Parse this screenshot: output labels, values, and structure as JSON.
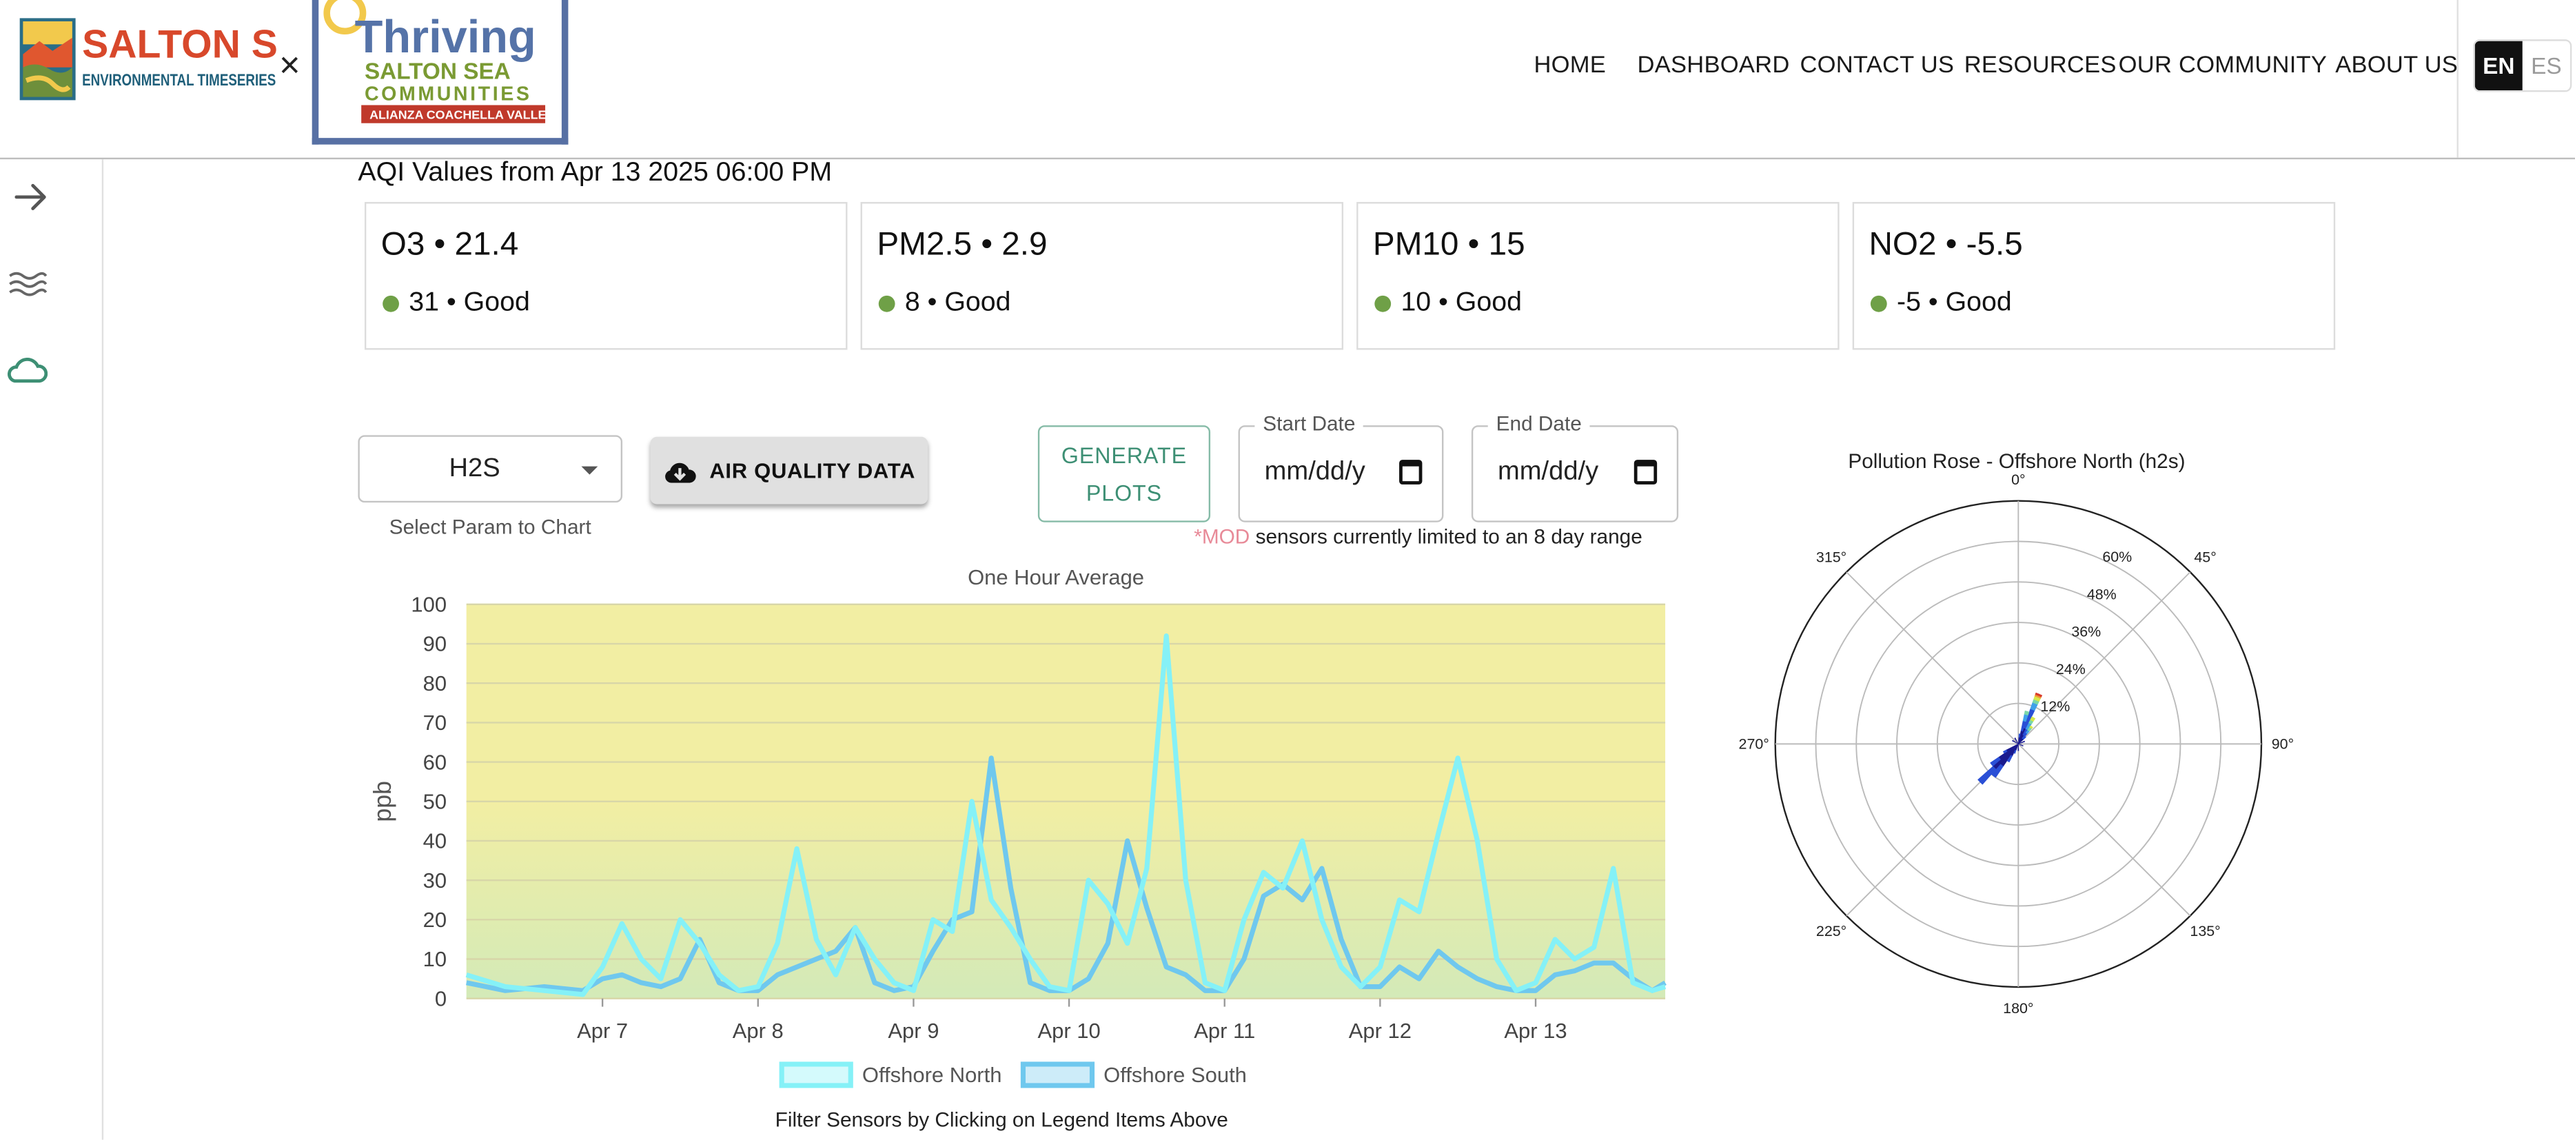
{
  "header": {
    "logo_salton": {
      "line1": "SALTON SEA",
      "line2": "ENVIRONMENTAL TIMESERIES"
    },
    "times_symbol": "×",
    "logo_thriving": {
      "line1": "Thriving",
      "line2": "SALTON SEA",
      "line3": "COMMUNITIES",
      "line4": "ALIANZA COACHELLA VALLEY"
    },
    "nav": [
      "HOME",
      "DASHBOARD",
      "CONTACT US",
      "RESOURCES",
      "OUR COMMUNITY",
      "ABOUT US"
    ],
    "lang": {
      "en": "EN",
      "es": "ES",
      "active": "EN"
    }
  },
  "sidebar": {
    "icons": [
      "arrow-right-icon",
      "waves-icon",
      "cloud-icon"
    ],
    "accent": "#3d8f74"
  },
  "aqi": {
    "title": "AQI Values from Apr 13 2025 06:00 PM",
    "cards": [
      {
        "title": "O3 • 21.4",
        "status": "31 • Good"
      },
      {
        "title": "PM2.5 • 2.9",
        "status": "8 • Good"
      },
      {
        "title": "PM10 • 15",
        "status": "10 • Good"
      },
      {
        "title": "NO2 • -5.5",
        "status": "-5 • Good"
      }
    ],
    "good_color": "#6fa047"
  },
  "controls": {
    "param": "H2S",
    "param_help": "Select Param to Chart",
    "download_label": "AIR QUALITY DATA",
    "generate_line1": "GENERATE",
    "generate_line2": "PLOTS",
    "start_label": "Start Date",
    "end_label": "End Date",
    "date_placeholder": "mm/dd/y",
    "note_mod": "*MOD",
    "note_text": " sensors currently limited to an 8 day range"
  },
  "chart_data": [
    {
      "type": "line",
      "title": "One Hour Average",
      "ylabel": "ppb",
      "ylim": [
        0,
        100
      ],
      "yticks": [
        0,
        10,
        20,
        30,
        40,
        50,
        60,
        70,
        80,
        90,
        100
      ],
      "xlim": [
        "Apr 6 2025 03:00",
        "Apr 13 2025 20:00"
      ],
      "xtick_labels": [
        "Apr 7",
        "Apr 8",
        "Apr 9",
        "Apr 10",
        "Apr 11",
        "Apr 12",
        "Apr 13"
      ],
      "xtick_dates": [
        "Apr 7 2025",
        "Apr 8 2025",
        "Apr 9 2025",
        "Apr 10 2025",
        "Apr 11 2025",
        "Apr 12 2025",
        "Apr 13 2025"
      ],
      "background_gradient": [
        "#f2eea3",
        "#d3eab8"
      ],
      "legend_hint": "Filter Sensors by Clicking on Legend Items Above",
      "series": [
        {
          "name": "Offshore North",
          "color": "#85f1f7",
          "points": [
            [
              "Apr 6 2025 03:00",
              6
            ],
            [
              "Apr 6 2025 09:00",
              3
            ],
            [
              "Apr 6 2025 15:00",
              2
            ],
            [
              "Apr 6 2025 21:00",
              1
            ],
            [
              "Apr 7 2025 00:00",
              8
            ],
            [
              "Apr 7 2025 03:00",
              19
            ],
            [
              "Apr 7 2025 06:00",
              10
            ],
            [
              "Apr 7 2025 09:00",
              5
            ],
            [
              "Apr 7 2025 12:00",
              20
            ],
            [
              "Apr 7 2025 15:00",
              14
            ],
            [
              "Apr 7 2025 18:00",
              6
            ],
            [
              "Apr 7 2025 21:00",
              2
            ],
            [
              "Apr 8 2025 00:00",
              3
            ],
            [
              "Apr 8 2025 03:00",
              14
            ],
            [
              "Apr 8 2025 06:00",
              38
            ],
            [
              "Apr 8 2025 09:00",
              15
            ],
            [
              "Apr 8 2025 12:00",
              6
            ],
            [
              "Apr 8 2025 15:00",
              18
            ],
            [
              "Apr 8 2025 18:00",
              10
            ],
            [
              "Apr 8 2025 21:00",
              4
            ],
            [
              "Apr 9 2025 00:00",
              2
            ],
            [
              "Apr 9 2025 03:00",
              20
            ],
            [
              "Apr 9 2025 06:00",
              17
            ],
            [
              "Apr 9 2025 09:00",
              50
            ],
            [
              "Apr 9 2025 12:00",
              25
            ],
            [
              "Apr 9 2025 15:00",
              18
            ],
            [
              "Apr 9 2025 18:00",
              10
            ],
            [
              "Apr 9 2025 21:00",
              3
            ],
            [
              "Apr 10 2025 00:00",
              2
            ],
            [
              "Apr 10 2025 03:00",
              30
            ],
            [
              "Apr 10 2025 06:00",
              24
            ],
            [
              "Apr 10 2025 09:00",
              14
            ],
            [
              "Apr 10 2025 12:00",
              33
            ],
            [
              "Apr 10 2025 15:00",
              92
            ],
            [
              "Apr 10 2025 18:00",
              30
            ],
            [
              "Apr 10 2025 21:00",
              4
            ],
            [
              "Apr 11 2025 00:00",
              2
            ],
            [
              "Apr 11 2025 03:00",
              20
            ],
            [
              "Apr 11 2025 06:00",
              32
            ],
            [
              "Apr 11 2025 09:00",
              28
            ],
            [
              "Apr 11 2025 12:00",
              40
            ],
            [
              "Apr 11 2025 15:00",
              20
            ],
            [
              "Apr 11 2025 18:00",
              8
            ],
            [
              "Apr 11 2025 21:00",
              3
            ],
            [
              "Apr 12 2025 00:00",
              8
            ],
            [
              "Apr 12 2025 03:00",
              25
            ],
            [
              "Apr 12 2025 06:00",
              22
            ],
            [
              "Apr 12 2025 09:00",
              42
            ],
            [
              "Apr 12 2025 12:00",
              61
            ],
            [
              "Apr 12 2025 15:00",
              40
            ],
            [
              "Apr 12 2025 18:00",
              10
            ],
            [
              "Apr 12 2025 21:00",
              2
            ],
            [
              "Apr 13 2025 00:00",
              4
            ],
            [
              "Apr 13 2025 03:00",
              15
            ],
            [
              "Apr 13 2025 06:00",
              10
            ],
            [
              "Apr 13 2025 09:00",
              13
            ],
            [
              "Apr 13 2025 12:00",
              33
            ],
            [
              "Apr 13 2025 15:00",
              4
            ],
            [
              "Apr 13 2025 18:00",
              2
            ],
            [
              "Apr 13 2025 20:00",
              3
            ]
          ]
        },
        {
          "name": "Offshore South",
          "color": "#6fc8ee",
          "points": [
            [
              "Apr 6 2025 03:00",
              4
            ],
            [
              "Apr 6 2025 09:00",
              2
            ],
            [
              "Apr 6 2025 15:00",
              3
            ],
            [
              "Apr 6 2025 21:00",
              2
            ],
            [
              "Apr 7 2025 00:00",
              5
            ],
            [
              "Apr 7 2025 03:00",
              6
            ],
            [
              "Apr 7 2025 06:00",
              4
            ],
            [
              "Apr 7 2025 09:00",
              3
            ],
            [
              "Apr 7 2025 12:00",
              5
            ],
            [
              "Apr 7 2025 15:00",
              15
            ],
            [
              "Apr 7 2025 18:00",
              4
            ],
            [
              "Apr 7 2025 21:00",
              2
            ],
            [
              "Apr 8 2025 00:00",
              2
            ],
            [
              "Apr 8 2025 03:00",
              6
            ],
            [
              "Apr 8 2025 06:00",
              8
            ],
            [
              "Apr 8 2025 09:00",
              10
            ],
            [
              "Apr 8 2025 12:00",
              12
            ],
            [
              "Apr 8 2025 15:00",
              18
            ],
            [
              "Apr 8 2025 18:00",
              4
            ],
            [
              "Apr 8 2025 21:00",
              2
            ],
            [
              "Apr 9 2025 00:00",
              3
            ],
            [
              "Apr 9 2025 03:00",
              12
            ],
            [
              "Apr 9 2025 06:00",
              20
            ],
            [
              "Apr 9 2025 09:00",
              22
            ],
            [
              "Apr 9 2025 12:00",
              61
            ],
            [
              "Apr 9 2025 15:00",
              28
            ],
            [
              "Apr 9 2025 18:00",
              4
            ],
            [
              "Apr 9 2025 21:00",
              2
            ],
            [
              "Apr 10 2025 00:00",
              2
            ],
            [
              "Apr 10 2025 03:00",
              5
            ],
            [
              "Apr 10 2025 06:00",
              14
            ],
            [
              "Apr 10 2025 09:00",
              40
            ],
            [
              "Apr 10 2025 12:00",
              23
            ],
            [
              "Apr 10 2025 15:00",
              8
            ],
            [
              "Apr 10 2025 18:00",
              6
            ],
            [
              "Apr 10 2025 21:00",
              2
            ],
            [
              "Apr 11 2025 00:00",
              2
            ],
            [
              "Apr 11 2025 03:00",
              10
            ],
            [
              "Apr 11 2025 06:00",
              26
            ],
            [
              "Apr 11 2025 09:00",
              29
            ],
            [
              "Apr 11 2025 12:00",
              25
            ],
            [
              "Apr 11 2025 15:00",
              33
            ],
            [
              "Apr 11 2025 18:00",
              15
            ],
            [
              "Apr 11 2025 21:00",
              3
            ],
            [
              "Apr 12 2025 00:00",
              3
            ],
            [
              "Apr 12 2025 03:00",
              8
            ],
            [
              "Apr 12 2025 06:00",
              5
            ],
            [
              "Apr 12 2025 09:00",
              12
            ],
            [
              "Apr 12 2025 12:00",
              8
            ],
            [
              "Apr 12 2025 15:00",
              5
            ],
            [
              "Apr 12 2025 18:00",
              3
            ],
            [
              "Apr 12 2025 21:00",
              2
            ],
            [
              "Apr 13 2025 00:00",
              2
            ],
            [
              "Apr 13 2025 03:00",
              6
            ],
            [
              "Apr 13 2025 06:00",
              7
            ],
            [
              "Apr 13 2025 09:00",
              9
            ],
            [
              "Apr 13 2025 12:00",
              9
            ],
            [
              "Apr 13 2025 15:00",
              5
            ],
            [
              "Apr 13 2025 18:00",
              2
            ],
            [
              "Apr 13 2025 20:00",
              4
            ]
          ]
        }
      ]
    },
    {
      "type": "polar",
      "title": "Pollution Rose - Offshore North (h2s)",
      "angle_labels": [
        "0°",
        "45°",
        "90°",
        "135°",
        "180°",
        "225°",
        "270°",
        "315°"
      ],
      "angle_values": [
        0,
        45,
        90,
        135,
        180,
        225,
        270,
        315
      ],
      "radial_labels": [
        "12%",
        "24%",
        "36%",
        "48%",
        "60%"
      ],
      "radial_values": [
        12,
        24,
        36,
        48,
        60
      ],
      "rmax": 72,
      "direction": "clockwise from north",
      "colors": [
        "#1a1a8f",
        "#2a4fd6",
        "#3fa0e8",
        "#7ad7a8",
        "#d6e84a",
        "#f09a35",
        "#d93a2a"
      ],
      "bars": [
        {
          "dir": 22.5,
          "segments": [
            5,
            6,
            2,
            1,
            1,
            0.5,
            0.5
          ]
        },
        {
          "dir": 15,
          "segments": [
            4,
            3,
            2,
            1,
            0,
            0,
            0
          ]
        },
        {
          "dir": 30,
          "segments": [
            3,
            2,
            2,
            1,
            1,
            0,
            0
          ]
        },
        {
          "dir": 37.5,
          "segments": [
            2,
            2,
            1,
            1,
            0.5,
            0,
            0
          ]
        },
        {
          "dir": 7.5,
          "segments": [
            2,
            1,
            0,
            0,
            0,
            0,
            0
          ]
        },
        {
          "dir": 45,
          "segments": [
            2,
            1,
            0,
            0,
            0,
            0,
            0
          ]
        },
        {
          "dir": 225,
          "segments": [
            10,
            6,
            0,
            0,
            0,
            0,
            0
          ]
        },
        {
          "dir": 217.5,
          "segments": [
            8,
            4,
            0,
            0,
            0,
            0,
            0
          ]
        },
        {
          "dir": 232.5,
          "segments": [
            7,
            3,
            0,
            0,
            0,
            0,
            0
          ]
        },
        {
          "dir": 210,
          "segments": [
            4,
            2,
            0,
            0,
            0,
            0,
            0
          ]
        },
        {
          "dir": 240,
          "segments": [
            4,
            1,
            0,
            0,
            0,
            0,
            0
          ]
        },
        {
          "dir": 202.5,
          "segments": [
            2,
            1,
            0,
            0,
            0,
            0,
            0
          ]
        },
        {
          "dir": 180,
          "segments": [
            2,
            0,
            0,
            0,
            0,
            0,
            0
          ]
        },
        {
          "dir": 300,
          "segments": [
            2,
            0,
            0,
            0,
            0,
            0,
            0
          ]
        },
        {
          "dir": 330,
          "segments": [
            2,
            0,
            0,
            0,
            0,
            0,
            0
          ]
        },
        {
          "dir": 67.5,
          "segments": [
            2,
            0,
            0,
            0,
            0,
            0,
            0
          ]
        },
        {
          "dir": 112.5,
          "segments": [
            1.5,
            0,
            0,
            0,
            0,
            0,
            0
          ]
        }
      ]
    }
  ]
}
